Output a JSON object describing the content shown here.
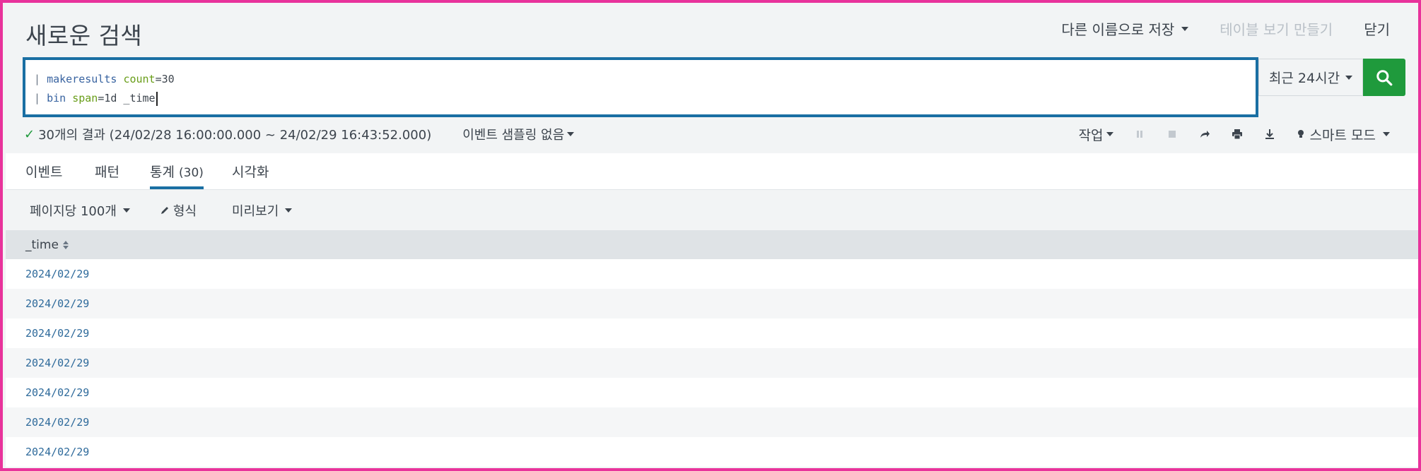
{
  "page_title": "새로운 검색",
  "header": {
    "save_as": "다른 이름으로 저장",
    "create_table_view": "테이블 보기 만들기",
    "close": "닫기"
  },
  "search": {
    "line1": {
      "pipe": "| ",
      "command": "makeresults",
      "arg_name": "count",
      "arg_value": "=30"
    },
    "line2": {
      "pipe": "| ",
      "command": "bin",
      "arg_name": "span",
      "arg_value": "=1d _time"
    },
    "time_range": "최근 24시간"
  },
  "status": {
    "result_summary": "30개의 결과 (24/02/28 16:00:00.000 ~ 24/02/29 16:43:52.000)",
    "sampling": "이벤트 샘플링 없음",
    "job": "작업",
    "mode": "스마트 모드"
  },
  "tabs": [
    {
      "label": "이벤트",
      "count": ""
    },
    {
      "label": "패턴",
      "count": ""
    },
    {
      "label": "통계",
      "count": "(30)"
    },
    {
      "label": "시각화",
      "count": ""
    }
  ],
  "toolbar": {
    "per_page": "페이지당 100개",
    "format": "형식",
    "preview": "미리보기"
  },
  "table": {
    "column": "_time",
    "rows": [
      "2024/02/29",
      "2024/02/29",
      "2024/02/29",
      "2024/02/29",
      "2024/02/29",
      "2024/02/29",
      "2024/02/29"
    ]
  },
  "colors": {
    "accent": "#1a6fa3",
    "search_button": "#1f9a3c",
    "frame_border": "#e8339b",
    "link_value": "#2e6a9b"
  }
}
